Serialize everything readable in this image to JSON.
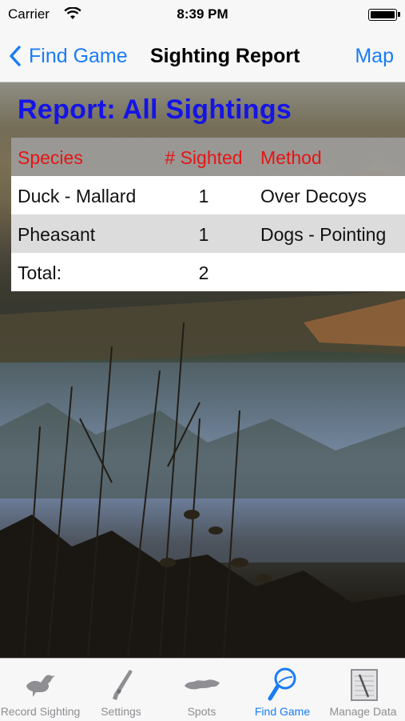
{
  "status_bar": {
    "carrier": "Carrier",
    "time": "8:39 PM"
  },
  "nav": {
    "back_label": "Find Game",
    "title": "Sighting Report",
    "right_label": "Map"
  },
  "report": {
    "title": "Report: All Sightings",
    "columns": [
      "Species",
      "# Sighted",
      "Method"
    ],
    "rows": [
      {
        "species": "Duck - Mallard",
        "count": "1",
        "method": "Over Decoys"
      },
      {
        "species": "Pheasant",
        "count": "1",
        "method": "Dogs - Pointing"
      }
    ],
    "total_label": "Total:",
    "total_value": "2"
  },
  "tabs": [
    {
      "label": "Record Sighting",
      "icon": "duck-icon",
      "active": false
    },
    {
      "label": "Settings",
      "icon": "rifle-icon",
      "active": false
    },
    {
      "label": "Spots",
      "icon": "spots-icon",
      "active": false
    },
    {
      "label": "Find Game",
      "icon": "magnifier-icon",
      "active": true
    },
    {
      "label": "Manage Data",
      "icon": "notepad-icon",
      "active": false
    }
  ],
  "colors": {
    "accent": "#1a7cf5",
    "report_title": "#1414e6",
    "column_header": "#e41515"
  }
}
